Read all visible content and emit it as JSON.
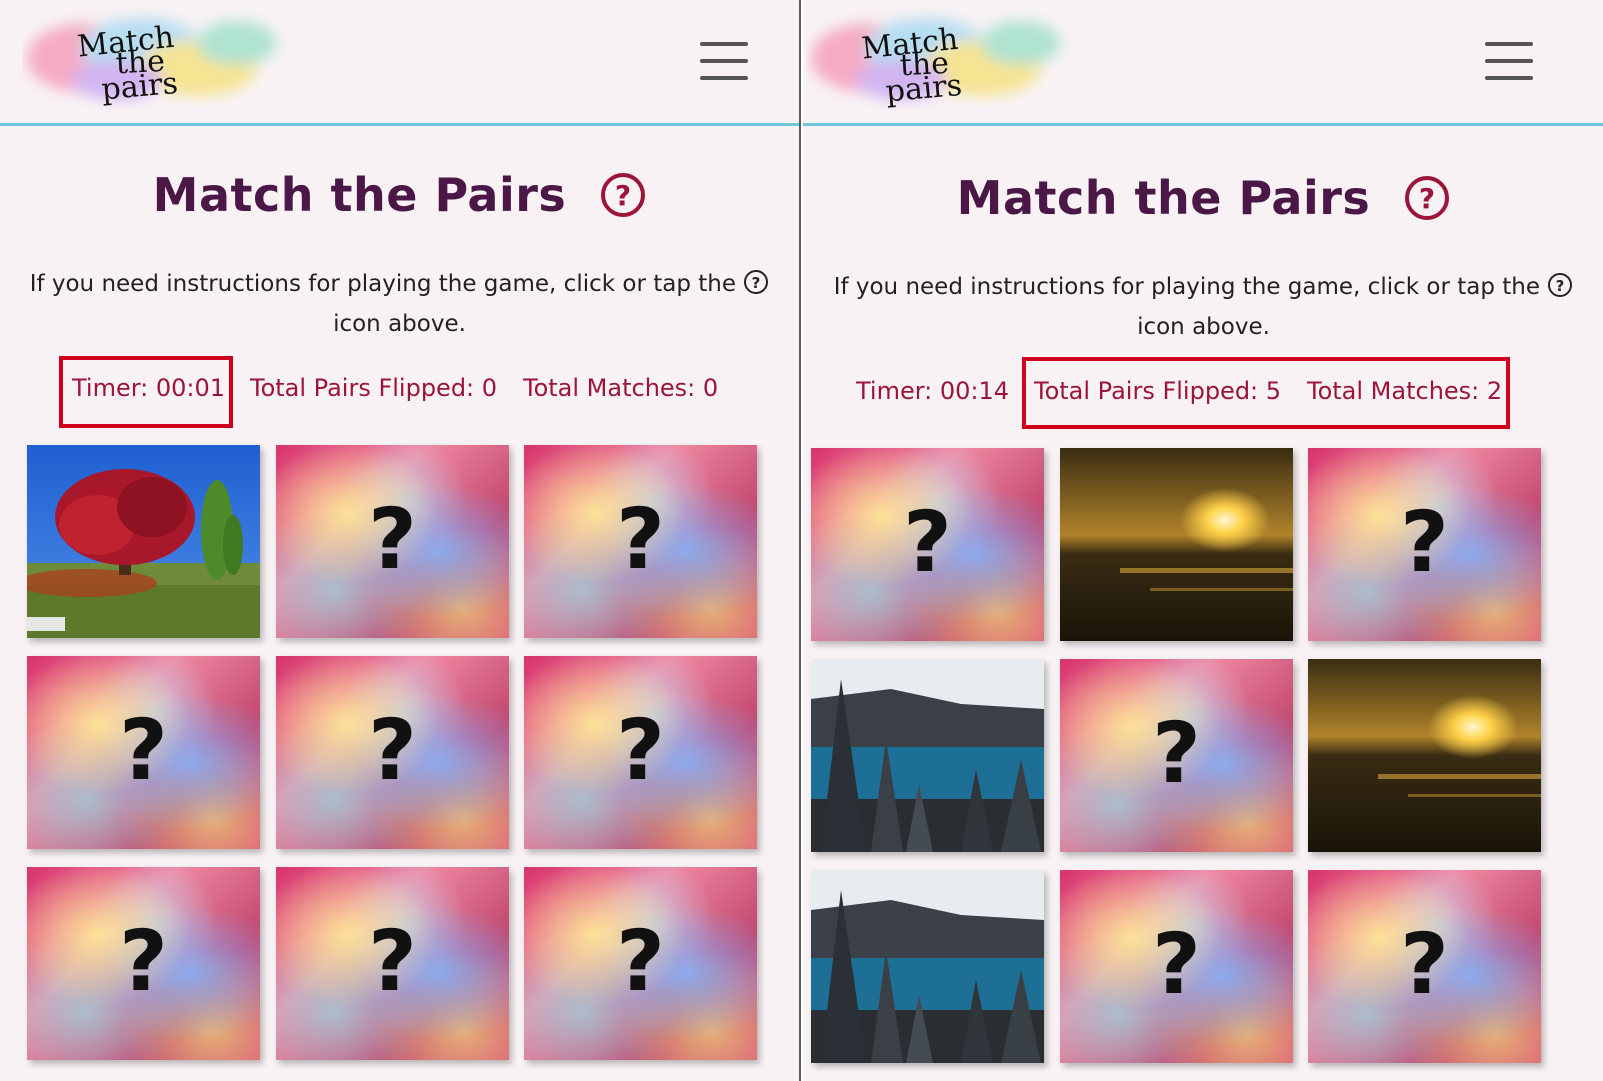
{
  "panels": [
    {
      "logo_text": [
        "Match",
        "the",
        "pairs"
      ],
      "title": "Match the Pairs",
      "instructions_before": "If you need instructions for playing the game, click or tap the",
      "instructions_after": "icon above.",
      "timer": "Timer: 00:01",
      "pairs_flipped": "Total Pairs Flipped: 0",
      "matches": "Total Matches: 0",
      "highlighted": [
        "timer"
      ],
      "cards": [
        "autumn-tree",
        "back",
        "back",
        "back",
        "back",
        "back",
        "back",
        "back",
        "back"
      ]
    },
    {
      "logo_text": [
        "Match",
        "the",
        "pairs"
      ],
      "title": "Match the Pairs",
      "instructions_before": "If you need instructions for playing the game, click or tap the",
      "instructions_after": "icon above.",
      "timer": "Timer: 00:14",
      "pairs_flipped": "Total Pairs Flipped: 5",
      "matches": "Total Matches: 2",
      "highlighted": [
        "pairs_flipped",
        "matches"
      ],
      "cards": [
        "back",
        "sunset",
        "back",
        "snowy-lake",
        "back",
        "sunset",
        "snowy-lake",
        "back",
        "back"
      ]
    }
  ],
  "card_back_symbol": "?",
  "icons": {
    "menu": "hamburger-icon",
    "help": "question-circle-icon"
  },
  "colors": {
    "title": "#4a1746",
    "stats": "#9c1538",
    "help_icon": "#9c1538",
    "header_border": "#6fc9d8",
    "highlight": "#d0021b",
    "background": "#f8f2f5"
  }
}
